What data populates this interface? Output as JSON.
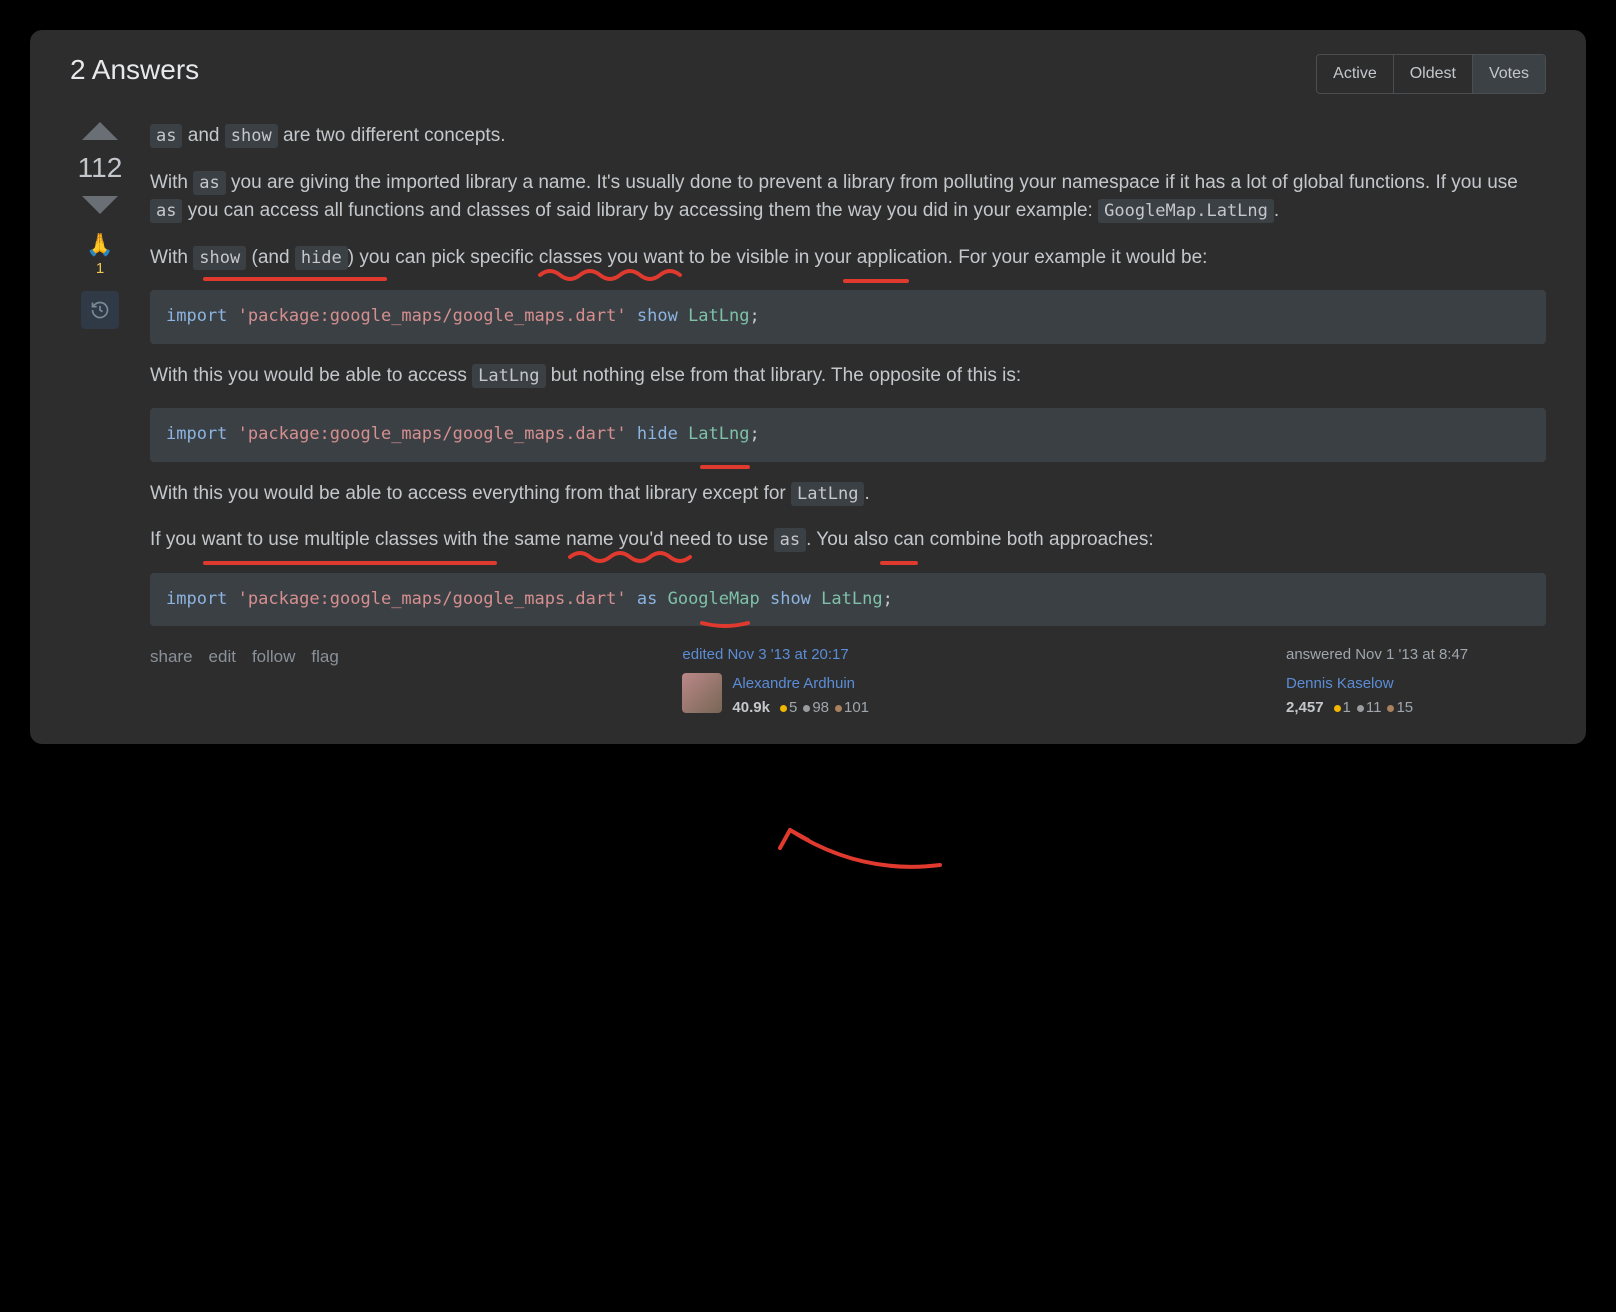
{
  "header": {
    "title": "2 Answers",
    "sort": {
      "active": "Active",
      "oldest": "Oldest",
      "votes": "Votes"
    }
  },
  "vote": {
    "score": "112",
    "bounty_icon": "🙏",
    "bounty_count": "1"
  },
  "content": {
    "p1a": "as",
    "p1b": " and ",
    "p1c": "show",
    "p1d": " are two different concepts.",
    "p2a": "With ",
    "p2b": "as",
    "p2c": " you are giving the imported library a name. It's usually done to prevent a library from polluting your namespace if it has a lot of global functions. If you use ",
    "p2d": "as",
    "p2e": " you can access all functions and classes of said library by accessing them the way you did in your example: ",
    "p2f": "GoogleMap.LatLng",
    "p2g": ".",
    "p3a": "With ",
    "p3b": "show",
    "p3c": " (and ",
    "p3d": "hide",
    "p3e": ") you can pick specific classes you want to be visible in your application. For your example it would be:",
    "code1": {
      "kw1": "import",
      "str": "'package:google_maps/google_maps.dart'",
      "kw2": "show",
      "typ": "LatLng",
      "tail": ";"
    },
    "p4a": "With this you would be able to access ",
    "p4b": "LatLng",
    "p4c": " but nothing else from that library. The opposite of this is:",
    "code2": {
      "kw1": "import",
      "str": "'package:google_maps/google_maps.dart'",
      "kw2": "hide",
      "typ": "LatLng",
      "tail": ";"
    },
    "p5a": "With this you would be able to access everything from that library except for ",
    "p5b": "LatLng",
    "p5c": ".",
    "p6a": "If you want to use multiple classes with the same name you'd need to use ",
    "p6b": "as",
    "p6c": ". You also can combine both approaches:",
    "code3": {
      "kw1": "import",
      "str": "'package:google_maps/google_maps.dart'",
      "kw2": "as",
      "typ1": "GoogleMap",
      "kw3": "show",
      "typ2": "LatLng",
      "tail": ";"
    }
  },
  "actions": {
    "share": "share",
    "edit": "edit",
    "follow": "follow",
    "flag": "flag"
  },
  "editor": {
    "label": "edited Nov 3 '13 at 20:17",
    "name": "Alexandre Ardhuin",
    "rep": "40.9k",
    "gold": "5",
    "silver": "98",
    "bronze": "101"
  },
  "author": {
    "label": "answered Nov 1 '13 at 8:47",
    "name": "Dennis Kaselow",
    "rep": "2,457",
    "gold": "1",
    "silver": "11",
    "bronze": "15"
  }
}
